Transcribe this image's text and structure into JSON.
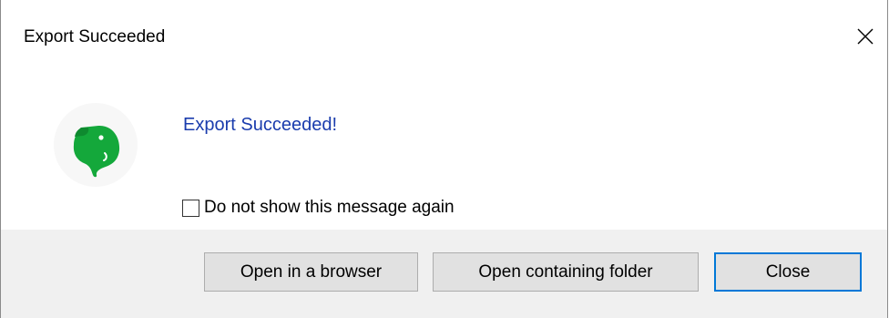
{
  "dialog": {
    "title": "Export Succeeded",
    "close_icon": "close-icon",
    "logo_icon": "evernote-elephant-icon",
    "message": "Export Succeeded!",
    "checkbox": {
      "label": "Do not show this message again",
      "checked": false
    },
    "buttons": {
      "open_browser": "Open in a browser",
      "open_folder": "Open containing folder",
      "close": "Close"
    }
  },
  "colors": {
    "message_text": "#1a3cad",
    "footer_bg": "#f0f0f0",
    "button_bg": "#e1e1e1",
    "default_button_border": "#0078d7",
    "logo_green": "#14a83b"
  }
}
